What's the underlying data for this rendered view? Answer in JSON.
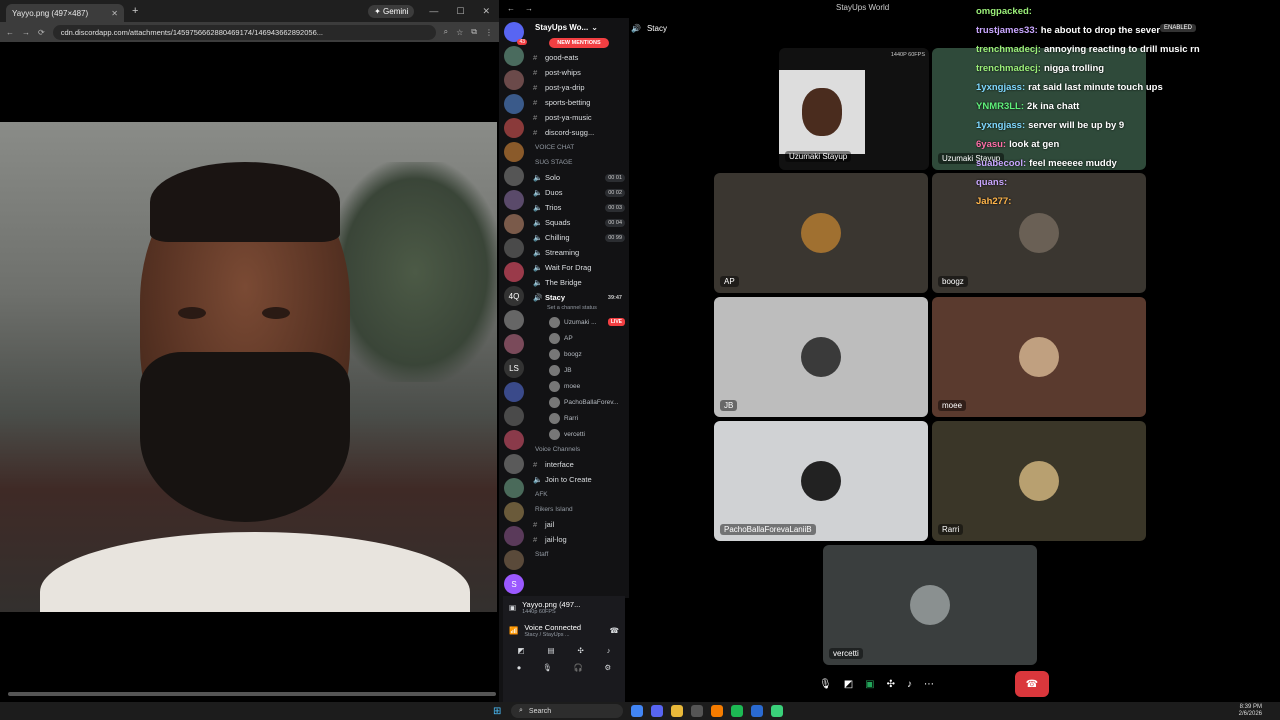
{
  "browser": {
    "tab_title": "Yayyo.png (497×487)",
    "tab_close": "✕",
    "new_tab": "+",
    "gemini_label": "✦ Gemini",
    "url": "cdn.discordapp.com/attachments/1459756662880469174/146943662892056..."
  },
  "discord": {
    "window_title": "StayUps World",
    "server_name": "StayUps Wo...",
    "voice_channel_header": "Stacy",
    "new_mentions": "NEW MENTIONS",
    "text_channels": [
      {
        "label": "good-eats"
      },
      {
        "label": "post-whips"
      },
      {
        "label": "post-ya-drip"
      },
      {
        "label": "sports-betting"
      },
      {
        "label": "post-ya-music"
      },
      {
        "label": "discord-sugg..."
      }
    ],
    "voice_chat_category": "VOICE CHAT",
    "sug_stage": "SUG STAGE",
    "voice_channels": [
      {
        "label": "Solo",
        "count": "00 01"
      },
      {
        "label": "Duos",
        "count": "00 02"
      },
      {
        "label": "Trios",
        "count": "00 03"
      },
      {
        "label": "Squads",
        "count": "00 04"
      },
      {
        "label": "Chilling",
        "count": "00 99"
      },
      {
        "label": "Streaming",
        "count": ""
      },
      {
        "label": "Wait For Drag",
        "count": ""
      },
      {
        "label": "The Bridge",
        "count": ""
      }
    ],
    "active_channel": "Stacy",
    "active_timer": "39:47",
    "channel_status": "Set a channel status",
    "members": [
      {
        "name": "Uzumaki ...",
        "live": "LIVE"
      },
      {
        "name": "AP",
        "live": ""
      },
      {
        "name": "boogz",
        "live": ""
      },
      {
        "name": "JB",
        "live": ""
      },
      {
        "name": "moee",
        "live": ""
      },
      {
        "name": "PachoBallaForev...",
        "live": ""
      },
      {
        "name": "Rarri",
        "live": ""
      },
      {
        "name": "vercetti",
        "live": ""
      }
    ],
    "voice_channels_category": "Voice Channels",
    "more_channels": [
      {
        "label": "interface"
      },
      {
        "label": "Join to Create"
      }
    ],
    "afk_category": "AFK",
    "rikers_category": "Rikers Island",
    "rikers_channels": [
      {
        "label": "jail"
      },
      {
        "label": "jail-log"
      }
    ],
    "staff_category": "Staff",
    "stream_name": "Yayyo.png (497...",
    "stream_quality": "1440p 60FPS",
    "voice_connected": "Voice Connected",
    "voice_location": "Stacy / StayUps ...",
    "stream_badge": "1440P 60FPS",
    "stream_live": "LIVE",
    "tiles": [
      {
        "name": "Uzumaki Stayup"
      },
      {
        "name": "Uzumaki Stayup"
      },
      {
        "name": "AP"
      },
      {
        "name": "boogz"
      },
      {
        "name": "JB"
      },
      {
        "name": "moee"
      },
      {
        "name": "PachoBallaForevaLaniiB"
      },
      {
        "name": "Rarri"
      },
      {
        "name": "vercetti"
      }
    ]
  },
  "chat_overlay": {
    "enabled_badge": "ENABLED",
    "messages": [
      {
        "user": "omgpacked:",
        "text": "",
        "color": "#9cf07a"
      },
      {
        "user": "trustjames33:",
        "text": "he about to drop the sever",
        "color": "#c9a7ff"
      },
      {
        "user": "trenchmadecj:",
        "text": "annoying reacting to drill music rn",
        "color": "#9cf07a"
      },
      {
        "user": "trenchmadecj:",
        "text": "nigga trolling",
        "color": "#9cf07a"
      },
      {
        "user": "1yxngjass:",
        "text": "rat said last minute touch ups",
        "color": "#7fd8ff"
      },
      {
        "user": "YNMR3LL:",
        "text": "2k ina chatt",
        "color": "#5ff07a"
      },
      {
        "user": "1yxngjass:",
        "text": "server will be up by 9",
        "color": "#7fd8ff"
      },
      {
        "user": "6yasu:",
        "text": "look at gen",
        "color": "#ff6fa8"
      },
      {
        "user": "suabecool:",
        "text": "feel meeeee muddy",
        "color": "#c9a7ff"
      },
      {
        "user": "quans:",
        "text": "",
        "color": "#c9a7ff"
      },
      {
        "user": "Jah277:",
        "text": "",
        "color": "#ffb54a"
      }
    ]
  },
  "taskbar": {
    "search": "Search",
    "time": "8:39 PM",
    "date": "2/6/2026"
  }
}
